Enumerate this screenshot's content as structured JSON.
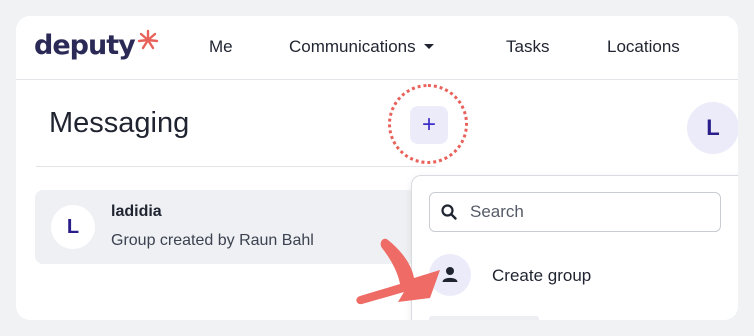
{
  "brand": {
    "logo_text": "deputy",
    "logo_mark_icon": "starburst-logo-icon",
    "logo_mark_color": "#e8615a",
    "logo_text_color": "#2b2a57"
  },
  "nav": {
    "items": [
      {
        "label": "Me"
      },
      {
        "label": "Communications",
        "has_dropdown": true
      },
      {
        "label": "Tasks"
      },
      {
        "label": "Locations"
      }
    ]
  },
  "messaging": {
    "title": "Messaging",
    "add_button_label": "+",
    "add_button_color": "#3d2ec8",
    "user_avatar_initial": "L"
  },
  "conversations": [
    {
      "avatar_initial": "L",
      "title": "ladidia",
      "subtitle": "Group created by Raun Bahl"
    }
  ],
  "new_menu": {
    "search": {
      "placeholder": "Search",
      "value": "",
      "icon": "search-icon"
    },
    "items": [
      {
        "label": "Create group",
        "icon": "person-icon"
      }
    ]
  },
  "annotation": {
    "highlight_color": "#e8615a",
    "arrow_icon": "pointing-arrow-icon"
  }
}
